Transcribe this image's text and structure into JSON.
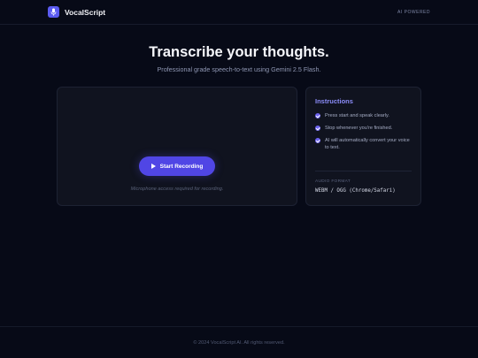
{
  "header": {
    "brand_name": "VocalScript",
    "logo_icon": "microphone-icon",
    "badge": "AI POWERED"
  },
  "hero": {
    "title": "Transcribe your thoughts.",
    "subtitle": "Professional grade speech-to-text using Gemini 2.5 Flash."
  },
  "recorder": {
    "button_label": "Start Recording",
    "button_icon": "play-icon",
    "note": "Microphone access required for recording."
  },
  "instructions": {
    "title": "Instructions",
    "steps": [
      "Press start and speak clearly.",
      "Stop whenever you're finished.",
      "AI will automatically convert your voice to text."
    ],
    "format_label": "AUDIO FORMAT",
    "format_value": "WEBM / OGG (Chrome/Safari)"
  },
  "footer": {
    "text": "© 2024 VocalScript AI. All rights reserved."
  },
  "colors": {
    "background": "#070a17",
    "accent": "#5046e5",
    "panel": "#10131f",
    "instructions_title": "#8b8cf8"
  }
}
